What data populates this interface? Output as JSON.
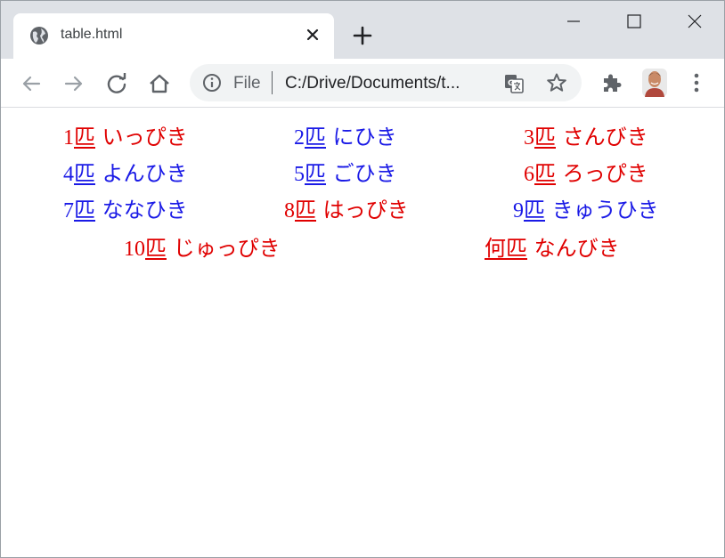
{
  "browser": {
    "tab_title": "table.html",
    "address_scheme_label": "File",
    "address_url": "C:/Drive/Documents/t..."
  },
  "colors": {
    "red": "#e00000",
    "blue": "#1a1ae6"
  },
  "icons": [
    "globe-icon",
    "close-icon",
    "plus-icon",
    "minimize-icon",
    "maximize-icon",
    "window-close-icon",
    "back-arrow-icon",
    "forward-arrow-icon",
    "reload-icon",
    "home-icon",
    "info-icon",
    "translate-icon",
    "star-icon",
    "puzzle-icon",
    "kebab-menu-icon"
  ],
  "counters": [
    {
      "number": "1",
      "counter": "匹",
      "reading": "いっぴき",
      "color": "red"
    },
    {
      "number": "2",
      "counter": "匹",
      "reading": "にひき",
      "color": "blue"
    },
    {
      "number": "3",
      "counter": "匹",
      "reading": "さんびき",
      "color": "red"
    },
    {
      "number": "4",
      "counter": "匹",
      "reading": "よんひき",
      "color": "blue"
    },
    {
      "number": "5",
      "counter": "匹",
      "reading": "ごひき",
      "color": "blue"
    },
    {
      "number": "6",
      "counter": "匹",
      "reading": "ろっぴき",
      "color": "red"
    },
    {
      "number": "7",
      "counter": "匹",
      "reading": "ななひき",
      "color": "blue"
    },
    {
      "number": "8",
      "counter": "匹",
      "reading": "はっぴき",
      "color": "red"
    },
    {
      "number": "9",
      "counter": "匹",
      "reading": "きゅうひき",
      "color": "blue"
    },
    {
      "number": "10",
      "counter": "匹",
      "reading": "じゅっぴき",
      "color": "red"
    },
    {
      "number": "",
      "counter": "何匹",
      "reading": "なんびき",
      "color": "red"
    }
  ]
}
